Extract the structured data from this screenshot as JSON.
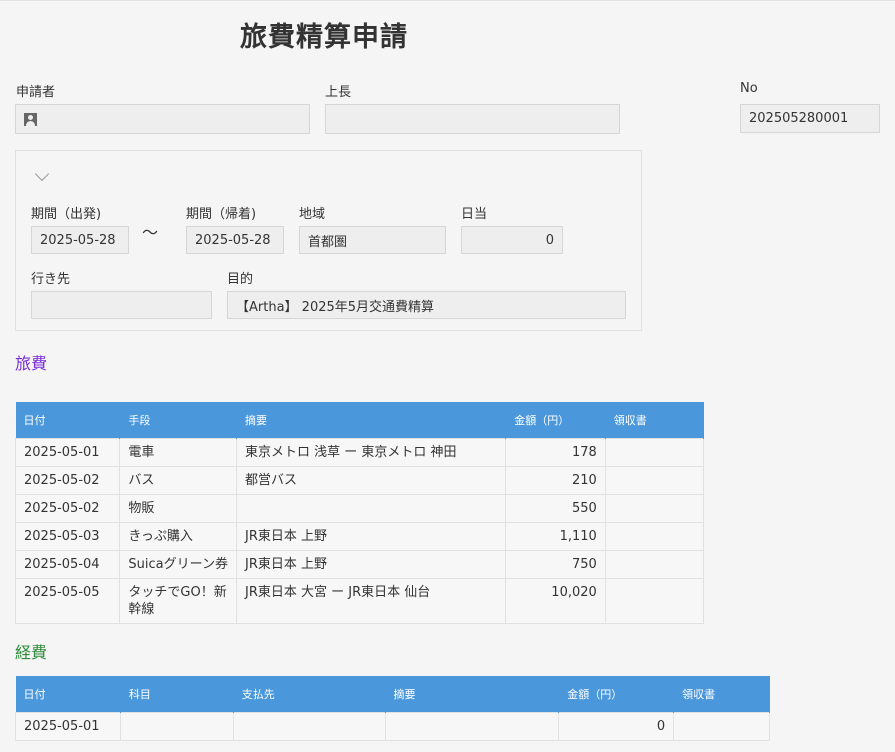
{
  "title": "旅費精算申請",
  "header": {
    "applicant_label": "申請者",
    "applicant_value": "",
    "boss_label": "上長",
    "boss_value": "",
    "no_label": "No",
    "no_value": "202505280001"
  },
  "group": {
    "start_label": "期間（出発)",
    "start_value": "2025-05-28",
    "tilde": "～",
    "end_label": "期間（帰着)",
    "end_value": "2025-05-28",
    "region_label": "地域",
    "region_value": "首都圏",
    "allowance_label": "日当",
    "allowance_value": "0",
    "dest_label": "行き先",
    "dest_value": "",
    "purpose_label": "目的",
    "purpose_value": "【Artha】 2025年5月交通費精算"
  },
  "travel": {
    "heading": "旅費",
    "heading_color": "#7b2bd6",
    "headers": [
      "日付",
      "手段",
      "摘要",
      "金額（円）",
      "領収書"
    ],
    "rows": [
      [
        "2025-05-01",
        "電車",
        "東京メトロ 浅草 ー 東京メトロ 神田",
        "178",
        ""
      ],
      [
        "2025-05-02",
        "バス",
        "都営バス",
        "210",
        ""
      ],
      [
        "2025-05-02",
        "物販",
        "",
        "550",
        ""
      ],
      [
        "2025-05-03",
        "きっぷ購入",
        "JR東日本 上野",
        "1,110",
        ""
      ],
      [
        "2025-05-04",
        "Suicaグリーン券",
        "JR東日本 上野",
        "750",
        ""
      ],
      [
        "2025-05-05",
        "タッチでGO！新幹線",
        "JR東日本 大宮 ー JR東日本 仙台",
        "10,020",
        ""
      ]
    ]
  },
  "expense": {
    "heading": "経費",
    "heading_color": "#2e8b3a",
    "headers": [
      "日付",
      "科目",
      "支払先",
      "摘要",
      "金額（円）",
      "領収書"
    ],
    "rows": [
      [
        "2025-05-01",
        "",
        "",
        "",
        "0",
        ""
      ]
    ]
  },
  "colors": {
    "table_header": "#4a97dc"
  }
}
